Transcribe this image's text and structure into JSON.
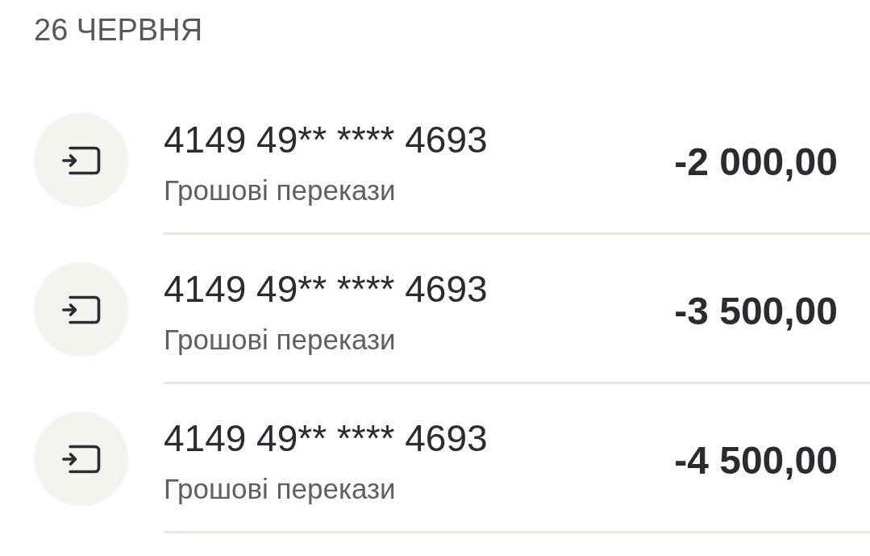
{
  "date_header": "26 ЧЕРВНЯ",
  "transactions": [
    {
      "card": "4149 49** **** 4693",
      "category": "Грошові перекази",
      "amount": "-2 000,00"
    },
    {
      "card": "4149 49** **** 4693",
      "category": "Грошові перекази",
      "amount": "-3 500,00"
    },
    {
      "card": "4149 49** **** 4693",
      "category": "Грошові перекази",
      "amount": "-4 500,00"
    }
  ]
}
